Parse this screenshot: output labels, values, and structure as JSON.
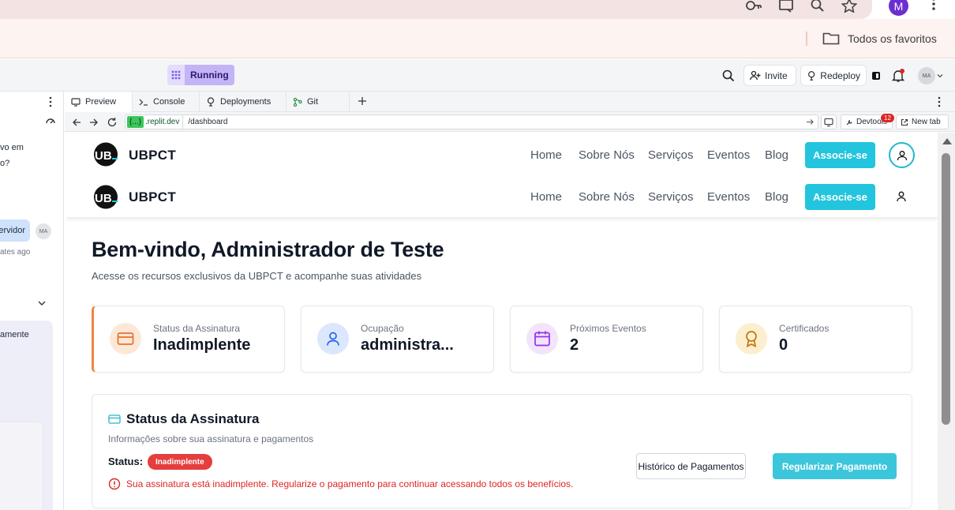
{
  "browser": {
    "profile_initial": "M",
    "bookmark_folder_label": "Todos os favoritos"
  },
  "replit": {
    "status": "Running",
    "invite_label": "Invite",
    "redeploy_label": "Redeploy",
    "avatar_initials": "MA",
    "tabs": [
      {
        "label": "Preview",
        "icon": "monitor-icon"
      },
      {
        "label": "Console",
        "icon": "terminal-icon"
      },
      {
        "label": "Deployments",
        "icon": "deploy-icon"
      },
      {
        "label": "Git",
        "icon": "git-icon"
      }
    ],
    "url_host": "{...}",
    "url_domain": ".replit.dev",
    "url_path": "/dashboard",
    "devtools_label": "Devtools",
    "devtools_count": "12",
    "newtab_label": "New tab"
  },
  "left_panel": {
    "line1": "vo em",
    "line2": "o?",
    "bubble": "ervidor",
    "avatar": "MA",
    "time": "ates ago",
    "card_text": "amente"
  },
  "site": {
    "brand": "UBPCT",
    "nav": [
      "Home",
      "Sobre Nós",
      "Serviços",
      "Eventos",
      "Blog"
    ],
    "cta": "Associe-se"
  },
  "dashboard": {
    "title": "Bem-vindo, Administrador de Teste",
    "subtitle": "Acesse os recursos exclusivos da UBPCT e acompanhe suas atividades",
    "stats": [
      {
        "label": "Status da Assinatura",
        "value": "Inadimplente",
        "icon": "credit-card-icon",
        "color": "#f2853b"
      },
      {
        "label": "Ocupação",
        "value": "administra...",
        "icon": "user-icon",
        "color": "#3b82f6"
      },
      {
        "label": "Próximos Eventos",
        "value": "2",
        "icon": "calendar-icon",
        "color": "#9333ea"
      },
      {
        "label": "Certificados",
        "value": "0",
        "icon": "award-icon",
        "color": "#d97706"
      }
    ],
    "subscription": {
      "title": "Status da Assinatura",
      "description": "Informações sobre sua assinatura e pagamentos",
      "status_label": "Status:",
      "status_badge": "Inadimplente",
      "warning": "Sua assinatura está inadimplente. Regularize o pagamento para continuar acessando todos os benefícios.",
      "history_button": "Histórico de Pagamentos",
      "pay_button": "Regularizar Pagamento"
    }
  },
  "colors": {
    "accent": "#22c5dd",
    "danger": "#e53e3e",
    "running": "#c5b3f7"
  }
}
